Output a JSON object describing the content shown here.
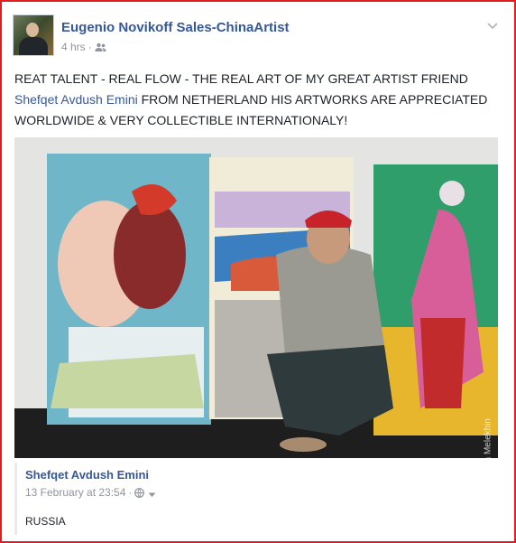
{
  "post": {
    "author": "Eugenio Novikoff Sales-ChinaArtist",
    "time": "4 hrs",
    "separator": "·",
    "audience_icon": "friends-icon",
    "menu_icon": "chevron-down-icon",
    "text_before": "REAT TALENT - REAL FLOW - THE REAL ART OF MY GREAT ARTIST FRIEND ",
    "mention": "Shefqet Avdush Emini",
    "text_after": " FROM NETHERLAND HIS ARTWORKS ARE APPRECIATED WORLDWIDE & VERY COLLECTIBLE INTERNATIONALY!"
  },
  "photo": {
    "watermark": "Elia Melekhin"
  },
  "shared": {
    "author": "Shefqet Avdush Emini",
    "date": "13 February at 23:54",
    "separator": "·",
    "audience_icon": "globe-icon",
    "text": "RUSSIA"
  },
  "colors": {
    "frame_border": "#e21d1d",
    "link": "#365899",
    "meta": "#90949c"
  }
}
